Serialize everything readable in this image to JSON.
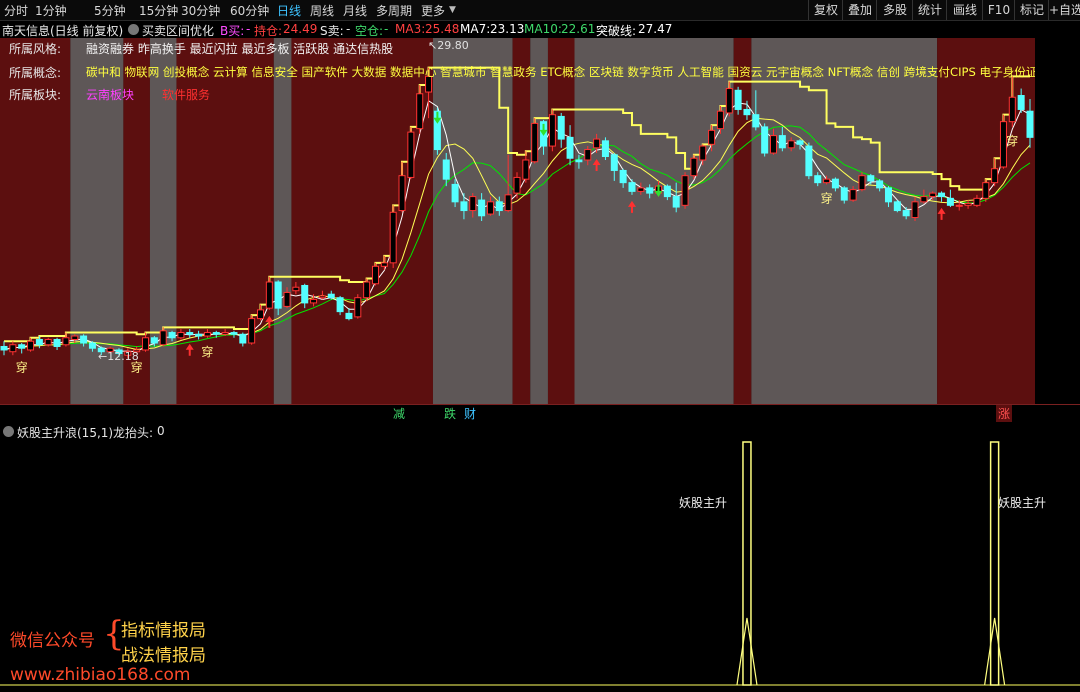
{
  "toolbar": {
    "periods": [
      "分时",
      "1分钟",
      "5分钟",
      "15分钟",
      "30分钟",
      "60分钟",
      "日线",
      "周线",
      "月线",
      "多周期",
      "更多"
    ],
    "active_period": "日线",
    "right_buttons": [
      "复权",
      "叠加",
      "多股",
      "统计",
      "画线",
      "F10",
      "标记",
      "+自选"
    ]
  },
  "infobar": {
    "stock": "南天信息(日线 前复权)",
    "indicator": "买卖区间优化",
    "b_buy_label": "B买:",
    "b_buy_value": "-",
    "hold_label": "持仓:",
    "hold_value": "24.49",
    "s_sell_label": "S卖:",
    "s_sell_value": "-",
    "empty_label": "空仓:",
    "empty_value": "-",
    "ma3_label": "MA3:",
    "ma3_value": "25.48",
    "ma7_label": "MA7:",
    "ma7_value": "23.13",
    "ma10_label": "MA10:",
    "ma10_value": "22.61",
    "breakout_label": "突破线:",
    "breakout_value": "27.47"
  },
  "overlay": {
    "style_label": "所属风格:",
    "style_text": "融资融券 昨高换手 最近闪拉 最近多板 活跃股 通达信热股",
    "concept_label": "所属概念:",
    "concept_text": "碳中和 物联网 创投概念 云计算 信息安全 国产软件 大数据 数据中心 智慧城市 智慧政务 ETC概念 区块链 数字货币 人工智能 国资云 元宇宙概念 NFT概念 信创 跨境支付CIPS 电子身份证",
    "sector_label": "所属板块:",
    "sector_region": "云南板块",
    "sector_industry": "软件服务"
  },
  "annotations": {
    "high_price": "29.80",
    "low_price": "12.18",
    "signal_char": "穿"
  },
  "event_markers": [
    {
      "label": "减",
      "color": "#3ed86a"
    },
    {
      "label": "跌",
      "color": "#3ed86a"
    },
    {
      "label": "财",
      "color": "#3ec3ff"
    },
    {
      "label": "涨",
      "color": "#ff5050"
    }
  ],
  "sub_indicator": {
    "title": "妖股主升浪(15,1)",
    "param_label": "龙抬头:",
    "param_value": "0",
    "signal_label": "妖股主升"
  },
  "watermark": {
    "account": "微信公众号",
    "line1": "指标情报局",
    "line2": "战法情报局",
    "url": "www.zhibiao168.com"
  },
  "colors": {
    "up": "#ff3232",
    "down": "#54ffff",
    "ma3": "#ffffff",
    "ma7": "#ffff54",
    "ma10": "#00e600",
    "breakout": "#ffff60",
    "hold_zone": "#5c0f0f",
    "empty_zone": "#5e5757"
  },
  "chart_data": {
    "type": "candlestick",
    "price_range": [
      10.5,
      31.5
    ],
    "candles": [
      [
        13.8,
        13.6,
        14.1,
        13.3
      ],
      [
        13.5,
        13.9,
        14.1,
        13.3
      ],
      [
        13.9,
        13.7,
        14.0,
        13.4
      ],
      [
        13.6,
        14.1,
        14.3,
        13.5
      ],
      [
        14.2,
        13.9,
        14.4,
        13.7
      ],
      [
        13.9,
        14.2,
        14.3,
        13.8
      ],
      [
        14.2,
        13.8,
        14.3,
        13.6
      ],
      [
        13.9,
        14.3,
        14.6,
        13.8
      ],
      [
        14.2,
        14.4,
        14.5,
        14.0
      ],
      [
        14.4,
        14.0,
        14.5,
        13.8
      ],
      [
        14.0,
        13.7,
        14.1,
        13.5
      ],
      [
        13.7,
        13.5,
        13.8,
        13.3
      ],
      [
        13.5,
        13.7,
        13.8,
        13.4
      ],
      [
        13.6,
        13.4,
        13.7,
        13.2
      ],
      [
        13.3,
        13.5,
        13.7,
        13.1
      ],
      [
        13.5,
        13.6,
        13.8,
        13.4
      ],
      [
        13.6,
        14.3,
        14.6,
        13.5
      ],
      [
        14.3,
        14.0,
        14.4,
        13.8
      ],
      [
        13.9,
        14.7,
        14.9,
        13.8
      ],
      [
        14.6,
        14.3,
        14.7,
        14.1
      ],
      [
        14.3,
        14.6,
        14.8,
        14.2
      ],
      [
        14.6,
        14.5,
        14.8,
        14.3
      ],
      [
        14.5,
        14.4,
        14.7,
        14.2
      ],
      [
        14.4,
        14.6,
        14.8,
        14.3
      ],
      [
        14.6,
        14.5,
        14.7,
        14.3
      ],
      [
        14.5,
        14.6,
        14.8,
        14.4
      ],
      [
        14.6,
        14.5,
        14.7,
        14.3
      ],
      [
        14.5,
        14.0,
        14.6,
        13.8
      ],
      [
        14.0,
        15.4,
        15.6,
        13.9
      ],
      [
        15.4,
        15.9,
        16.2,
        15.3
      ],
      [
        16.0,
        17.5,
        17.8,
        15.9
      ],
      [
        17.5,
        16.0,
        17.6,
        15.6
      ],
      [
        16.1,
        16.9,
        17.2,
        16.0
      ],
      [
        17.0,
        17.2,
        17.5,
        16.8
      ],
      [
        17.3,
        16.3,
        17.4,
        16.0
      ],
      [
        16.3,
        16.5,
        16.8,
        16.1
      ],
      [
        16.6,
        16.7,
        17.0,
        16.5
      ],
      [
        16.8,
        16.6,
        17.0,
        16.5
      ],
      [
        16.6,
        15.8,
        16.7,
        15.6
      ],
      [
        15.7,
        15.4,
        16.0,
        15.3
      ],
      [
        15.5,
        16.6,
        16.8,
        15.4
      ],
      [
        16.6,
        17.5,
        17.7,
        16.4
      ],
      [
        17.4,
        18.4,
        18.6,
        17.3
      ],
      [
        18.4,
        18.6,
        19.0,
        18.2
      ],
      [
        18.6,
        21.5,
        21.9,
        18.3
      ],
      [
        21.6,
        23.6,
        24.4,
        21.5
      ],
      [
        23.5,
        26.1,
        26.4,
        23.4
      ],
      [
        26.3,
        28.3,
        28.8,
        26.0
      ],
      [
        28.4,
        29.3,
        29.8,
        26.9
      ],
      [
        27.3,
        25.1,
        27.5,
        24.8
      ],
      [
        24.5,
        23.4,
        24.9,
        23.0
      ],
      [
        23.1,
        22.1,
        23.4,
        21.8
      ],
      [
        22.1,
        21.6,
        22.6,
        21.1
      ],
      [
        21.6,
        22.4,
        22.6,
        21.2
      ],
      [
        22.2,
        21.3,
        22.6,
        21.0
      ],
      [
        21.4,
        22.1,
        22.4,
        21.3
      ],
      [
        22.1,
        21.6,
        22.4,
        21.3
      ],
      [
        21.6,
        22.5,
        24.8,
        21.5
      ],
      [
        22.6,
        23.5,
        23.8,
        22.3
      ],
      [
        23.4,
        24.5,
        25.0,
        23.2
      ],
      [
        24.4,
        26.6,
        26.9,
        24.3
      ],
      [
        26.7,
        25.3,
        26.8,
        24.8
      ],
      [
        25.3,
        27.1,
        27.4,
        25.0
      ],
      [
        27.0,
        25.7,
        27.2,
        25.2
      ],
      [
        25.8,
        24.6,
        26.5,
        24.2
      ],
      [
        24.5,
        24.4,
        24.8,
        24.0
      ],
      [
        24.5,
        25.1,
        25.3,
        24.2
      ],
      [
        25.2,
        25.7,
        26.0,
        24.9
      ],
      [
        25.6,
        24.7,
        25.8,
        24.5
      ],
      [
        24.8,
        23.9,
        24.9,
        23.3
      ],
      [
        23.9,
        23.2,
        24.0,
        22.9
      ],
      [
        23.2,
        22.7,
        23.4,
        22.5
      ],
      [
        22.7,
        22.9,
        23.2,
        22.5
      ],
      [
        22.9,
        22.6,
        23.1,
        22.3
      ],
      [
        22.6,
        23.0,
        23.3,
        22.4
      ],
      [
        23.0,
        22.4,
        23.1,
        22.2
      ],
      [
        22.4,
        21.8,
        23.2,
        21.5
      ],
      [
        21.9,
        23.6,
        23.8,
        21.7
      ],
      [
        23.6,
        24.6,
        24.8,
        23.4
      ],
      [
        24.5,
        25.3,
        25.4,
        24.2
      ],
      [
        25.4,
        26.2,
        26.5,
        25.0
      ],
      [
        26.3,
        27.3,
        27.6,
        26.0
      ],
      [
        27.2,
        28.6,
        29.0,
        27.0
      ],
      [
        28.5,
        27.4,
        28.7,
        27.1
      ],
      [
        27.4,
        27.1,
        27.9,
        26.8
      ],
      [
        27.1,
        26.4,
        28.5,
        26.2
      ],
      [
        26.4,
        24.9,
        26.6,
        24.7
      ],
      [
        24.9,
        25.9,
        26.3,
        24.8
      ],
      [
        25.9,
        25.2,
        26.4,
        25.0
      ],
      [
        25.2,
        25.6,
        25.8,
        25.0
      ],
      [
        25.6,
        25.4,
        25.7,
        25.1
      ],
      [
        25.3,
        23.6,
        25.5,
        23.4
      ],
      [
        23.6,
        23.2,
        23.8,
        23.0
      ],
      [
        23.2,
        23.4,
        23.6,
        23.1
      ],
      [
        23.4,
        22.9,
        23.5,
        22.7
      ],
      [
        22.9,
        22.2,
        23.0,
        22.0
      ],
      [
        22.2,
        22.8,
        23.0,
        22.1
      ],
      [
        22.8,
        23.6,
        23.8,
        22.7
      ],
      [
        23.6,
        23.3,
        23.7,
        23.1
      ],
      [
        23.3,
        22.9,
        23.4,
        22.7
      ],
      [
        22.9,
        22.1,
        23.0,
        21.8
      ],
      [
        22.1,
        21.6,
        22.2,
        21.5
      ],
      [
        21.6,
        21.3,
        21.8,
        21.1
      ],
      [
        21.2,
        22.1,
        22.4,
        21.0
      ],
      [
        22.1,
        22.4,
        22.8,
        22.0
      ],
      [
        22.4,
        22.6,
        22.7,
        22.2
      ],
      [
        22.6,
        22.4,
        22.7,
        22.1
      ],
      [
        22.3,
        21.9,
        22.8,
        21.8
      ],
      [
        21.9,
        21.9,
        22.2,
        21.6
      ],
      [
        21.9,
        22.0,
        22.2,
        21.7
      ],
      [
        21.9,
        22.3,
        22.5,
        21.8
      ],
      [
        22.3,
        23.2,
        23.4,
        22.1
      ],
      [
        23.2,
        24.0,
        24.6,
        23.0
      ],
      [
        24.1,
        26.7,
        27.1,
        24.0
      ],
      [
        26.7,
        28.1,
        29.3,
        26.4
      ],
      [
        28.2,
        27.4,
        28.6,
        27.2
      ],
      [
        27.3,
        25.8,
        28.0,
        25.2
      ]
    ],
    "zones": [
      {
        "from": 0,
        "to": 7,
        "state": "hold"
      },
      {
        "from": 8,
        "to": 13,
        "state": "empty"
      },
      {
        "from": 14,
        "to": 16,
        "state": "hold"
      },
      {
        "from": 17,
        "to": 19,
        "state": "empty"
      },
      {
        "from": 20,
        "to": 30,
        "state": "hold"
      },
      {
        "from": 31,
        "to": 32,
        "state": "empty"
      },
      {
        "from": 33,
        "to": 48,
        "state": "hold"
      },
      {
        "from": 49,
        "to": 57,
        "state": "empty"
      },
      {
        "from": 58,
        "to": 59,
        "state": "hold"
      },
      {
        "from": 60,
        "to": 61,
        "state": "empty"
      },
      {
        "from": 62,
        "to": 64,
        "state": "hold"
      },
      {
        "from": 65,
        "to": 82,
        "state": "empty"
      },
      {
        "from": 83,
        "to": 84,
        "state": "hold"
      },
      {
        "from": 85,
        "to": 105,
        "state": "empty"
      },
      {
        "from": 106,
        "to": 117,
        "state": "hold"
      }
    ],
    "signals_up": [
      21,
      30,
      67,
      71,
      106
    ],
    "signals_down": [
      49,
      61,
      74
    ],
    "chuan_signals": [
      2,
      15,
      23,
      93,
      114
    ],
    "sub_peaks": [
      84,
      112
    ]
  }
}
